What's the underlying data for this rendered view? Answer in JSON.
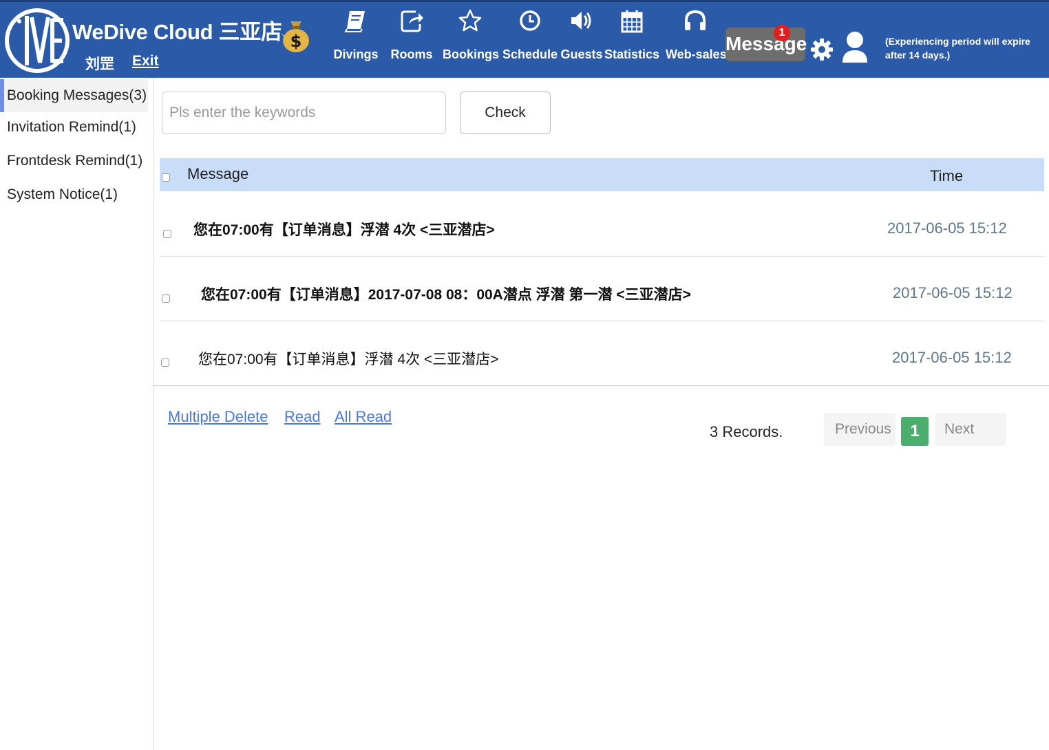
{
  "header": {
    "brand": "WeDive Cloud 三亚店",
    "brand_chevron": "⌵",
    "user_name": "刘罡",
    "exit_label": "Exit",
    "nav": [
      {
        "label": "Divings",
        "icon": "book-icon"
      },
      {
        "label": "Rooms",
        "icon": "share-icon"
      },
      {
        "label": "Bookings",
        "icon": "star-icon"
      },
      {
        "label": "Schedule",
        "icon": "clock-icon"
      },
      {
        "label": "Guests",
        "icon": "volume-icon"
      },
      {
        "label": "Statistics",
        "icon": "calendar-icon"
      },
      {
        "label": "Web-sales",
        "icon": "headphones-icon"
      }
    ],
    "message_label": "Message",
    "message_badge": "1",
    "expire_notice": "(Experiencing period will expire after 14 days.)",
    "colors": {
      "bar": "#2b5ba8",
      "badge": "#e02020"
    }
  },
  "sidebar": {
    "items": [
      {
        "label": "Booking Messages(3)",
        "active": true
      },
      {
        "label": "Invitation Remind(1)",
        "active": false
      },
      {
        "label": "Frontdesk Remind(1)",
        "active": false
      },
      {
        "label": "System Notice(1)",
        "active": false
      }
    ]
  },
  "search": {
    "placeholder": "Pls enter the keywords",
    "value": "",
    "button_label": "Check"
  },
  "table": {
    "headers": {
      "message": "Message",
      "time": "Time"
    },
    "rows": [
      {
        "message": "您在07:00有【订单消息】浮潜 4次 <三亚潜店>",
        "time": "2017-06-05 15:12",
        "unread": true
      },
      {
        "message": "您在07:00有【订单消息】2017-07-08 08：00A潜点 浮潜 第一潜 <三亚潜店>",
        "time": "2017-06-05 15:12",
        "unread": true
      },
      {
        "message": "您在07:00有【订单消息】浮潜 4次 <三亚潜店>",
        "time": "2017-06-05 15:12",
        "unread": false
      }
    ]
  },
  "actions": {
    "multiple_delete": "Multiple Delete",
    "read": "Read",
    "all_read": "All Read"
  },
  "pagination": {
    "records": "3 Records.",
    "previous": "Previous",
    "current_page": "1",
    "next": "Next"
  }
}
